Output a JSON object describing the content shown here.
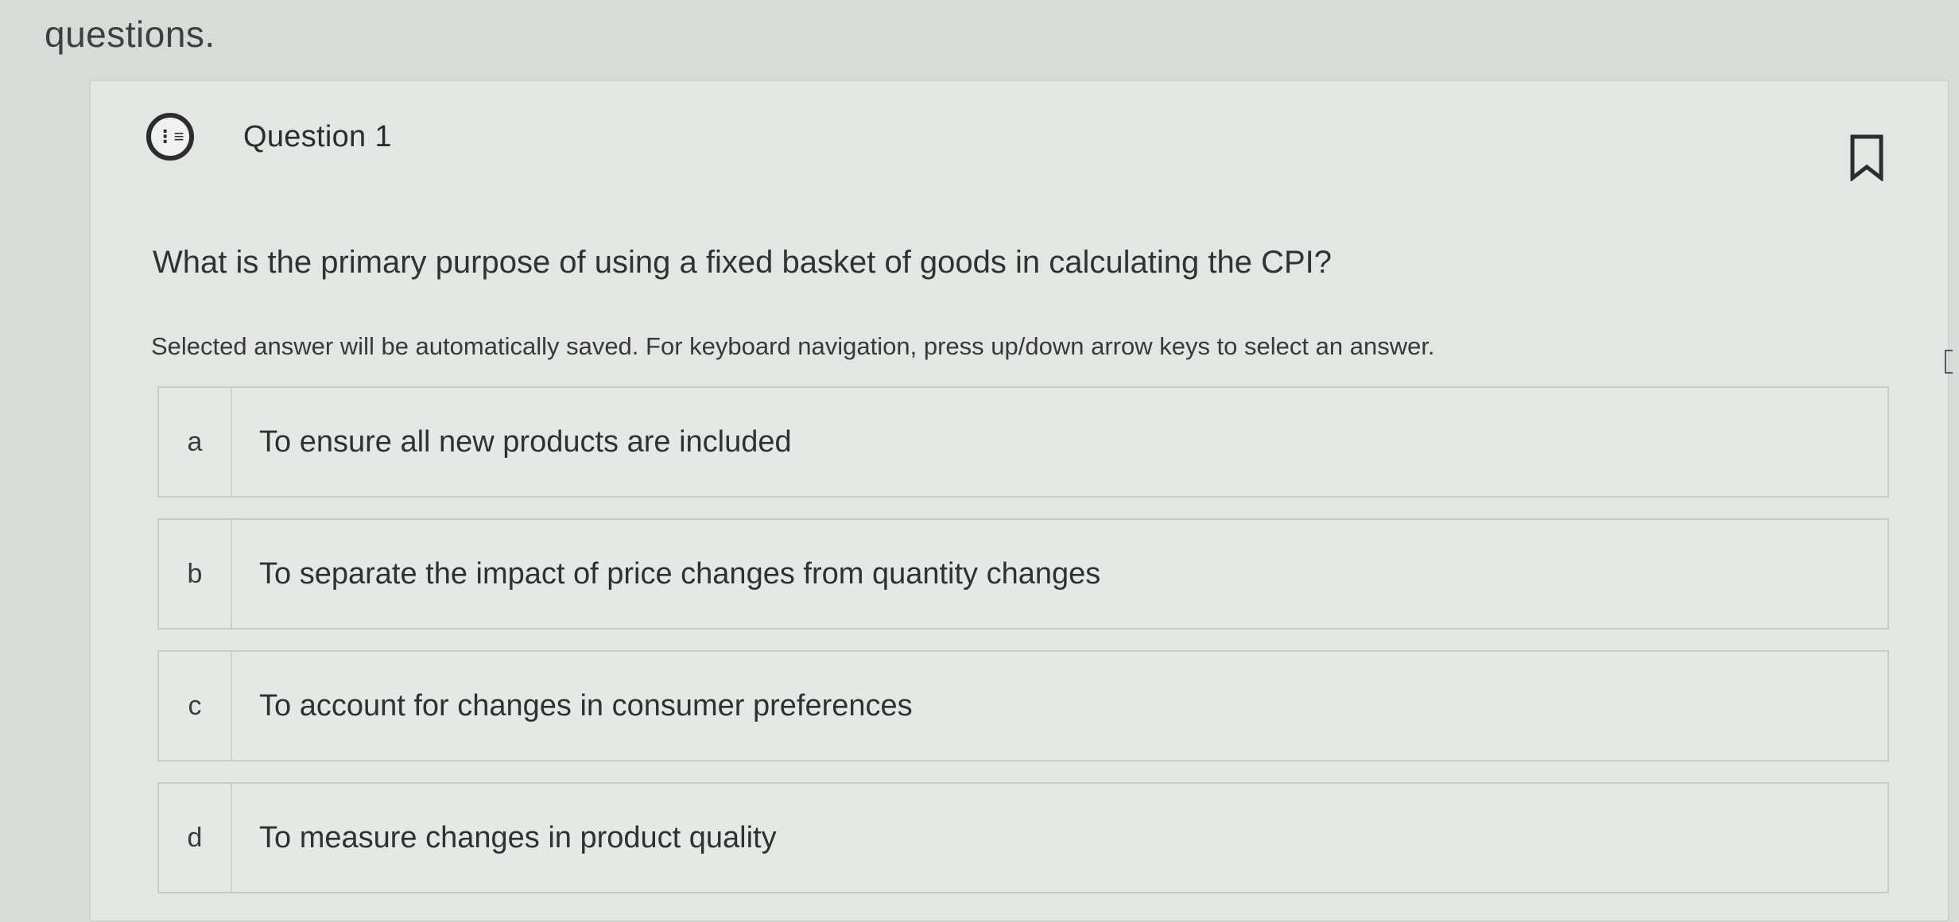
{
  "page": {
    "heading": "questions."
  },
  "question": {
    "icon": "list-icon",
    "title": "Question 1",
    "text": "What is the primary purpose of using a fixed basket of goods in calculating the CPI?",
    "instructions": "Selected answer will be automatically saved. For keyboard navigation, press up/down arrow keys to select an answer.",
    "bookmark_icon": "bookmark-icon"
  },
  "options": [
    {
      "letter": "a",
      "text": "To ensure all new products are included"
    },
    {
      "letter": "b",
      "text": "To separate the impact of price changes from quantity changes"
    },
    {
      "letter": "c",
      "text": "To account for changes in consumer preferences"
    },
    {
      "letter": "d",
      "text": "To measure changes in product quality"
    }
  ]
}
